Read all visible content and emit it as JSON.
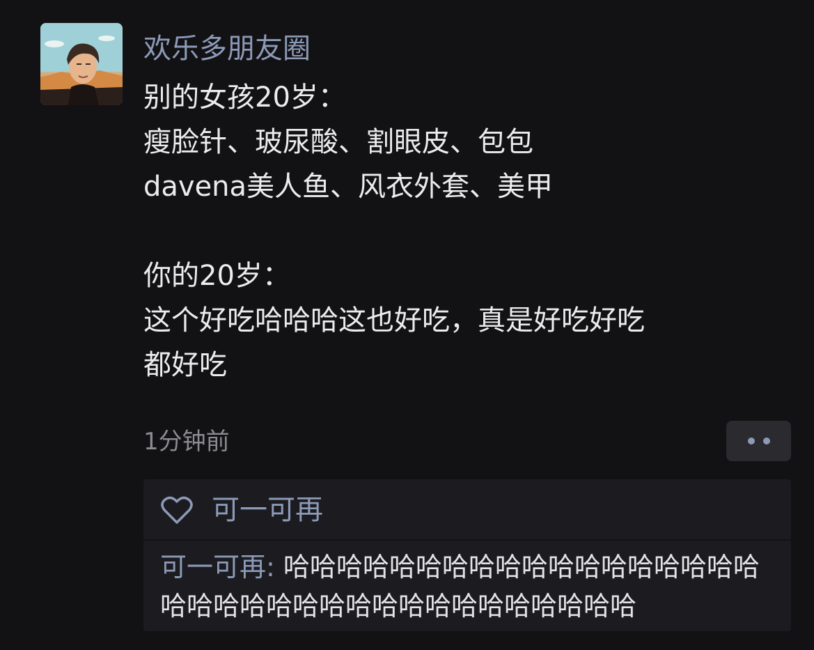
{
  "post": {
    "avatar_icon": "avatar-illustrated-man",
    "username": "欢乐多朋友圈",
    "content_lines": [
      "别的女孩20岁：",
      "瘦脸针、玻尿酸、割眼皮、包包",
      "davena美人鱼、风衣外套、美甲",
      "",
      "你的20岁：",
      "这个好吃哈哈哈这也好吃，真是好吃好吃",
      "都好吃"
    ],
    "timestamp": "1分钟前",
    "more_icon": "two-dots-more-icon"
  },
  "interactions": {
    "like_icon": "heart-outline-icon",
    "likes_user": "可一可再",
    "comment": {
      "author": "可一可再",
      "separator": ": ",
      "text": "哈哈哈哈哈哈哈哈哈哈哈哈哈哈哈哈哈哈哈哈哈哈哈哈哈哈哈哈哈哈哈哈哈哈哈哈"
    }
  },
  "colors": {
    "background": "#121214",
    "name_link": "#8c9ab8",
    "text": "#ececee",
    "muted": "#8b8b90",
    "panel": "#1c1c20"
  }
}
